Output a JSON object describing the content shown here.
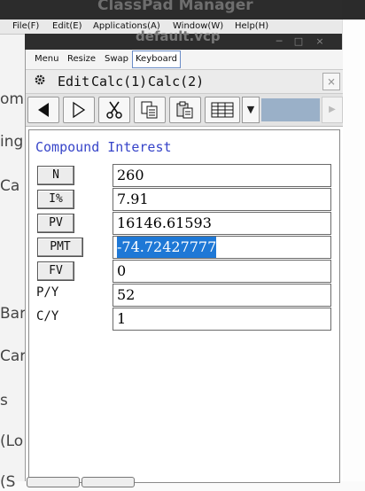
{
  "background_app": {
    "title": "ClassPad Manager",
    "left_fragments": [
      "omo",
      "ing",
      "Ca",
      "Bar",
      "Car",
      "s",
      "(Lo",
      "(S"
    ]
  },
  "menubar": {
    "items": [
      "File(F)",
      "Edit(E)",
      "Applications(A)",
      "Window(W)",
      "Help(H)"
    ]
  },
  "document_window": {
    "title": "default.vcp"
  },
  "tabs": [
    "Menu",
    "Resize",
    "Swap",
    "Keyboard"
  ],
  "app_menu": {
    "items": [
      "Edit",
      "Calc(1)",
      "Calc(2)"
    ]
  },
  "toolbar": {
    "buttons": [
      "left-arrow-icon",
      "right-arrow-icon",
      "scissors-icon",
      "copy-icon",
      "paste-icon",
      "spreadsheet-icon",
      "dropdown-arrow-icon"
    ]
  },
  "financial": {
    "heading": "Compound Interest",
    "rows": [
      {
        "label": "N",
        "value": "260",
        "button": true
      },
      {
        "label": "I%",
        "value": "7.91",
        "button": true
      },
      {
        "label": "PV",
        "value": "16146.61593",
        "button": true
      },
      {
        "label": "PMT",
        "value": "-74.72427777",
        "button": true,
        "selected": true
      },
      {
        "label": "FV",
        "value": "0",
        "button": true
      },
      {
        "label": "P/Y",
        "value": "52",
        "button": false
      },
      {
        "label": "C/Y",
        "value": "1",
        "button": false
      }
    ]
  },
  "colors": {
    "heading": "#3745c9",
    "selection": "#1e78d6",
    "toolbar_accent": "#9ab0c8"
  }
}
